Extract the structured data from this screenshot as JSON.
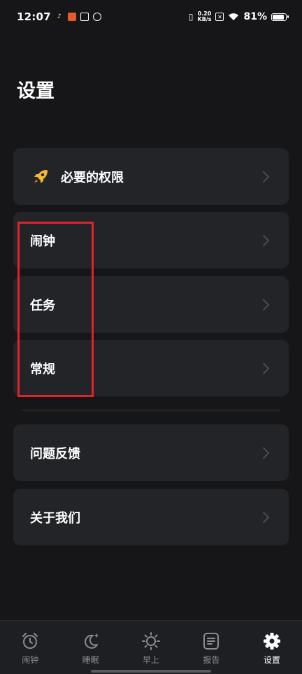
{
  "status_bar": {
    "time": "12:07",
    "net_speed_value": "0.20",
    "net_speed_unit": "KB/s",
    "battery": "81%",
    "battery_level": 0.81
  },
  "page": {
    "title": "设置"
  },
  "menu": {
    "permissions": "必要的权限",
    "alarm": "闹钟",
    "task": "任务",
    "general": "常规",
    "feedback": "问题反馈",
    "about": "关于我们"
  },
  "bottom_nav": {
    "items": [
      {
        "label": "闹钟",
        "icon": "alarm-clock-icon"
      },
      {
        "label": "睡眠",
        "icon": "moon-icon"
      },
      {
        "label": "早上",
        "icon": "sun-icon"
      },
      {
        "label": "报告",
        "icon": "report-icon"
      },
      {
        "label": "设置",
        "icon": "gear-icon"
      }
    ],
    "active_index": 4
  },
  "colors": {
    "background": "#161618",
    "card": "#232428",
    "highlight": "#e0222b",
    "accent_rocket": "#f5b82e"
  }
}
